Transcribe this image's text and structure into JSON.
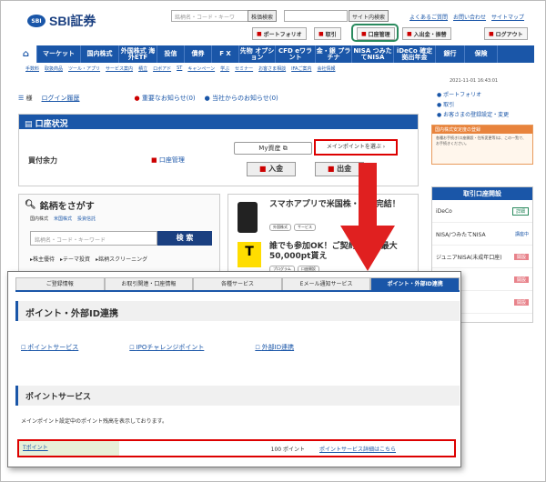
{
  "header": {
    "logo": "SBI証券",
    "search_placeholder": "銘柄名・コード・キーワ",
    "stock_search_btn": "株価検索",
    "site_search_btn": "サイト内検索",
    "links": [
      "よくあるご質問",
      "お問い合わせ",
      "サイトマップ"
    ],
    "buttons": [
      "ポートフォリオ",
      "取引",
      "口座管理",
      "入出金・振替",
      "ログアウト"
    ]
  },
  "nav": {
    "items": [
      "マーケット",
      "国内株式",
      "外国株式 海外ETF",
      "投信",
      "債券",
      "F X",
      "先物 オプション",
      "CFD eワラント",
      "金・銀 プラチナ",
      "NISA つみたてNISA",
      "iDeCo 確定拠出年金",
      "銀行",
      "保険"
    ],
    "sub": [
      "手数料",
      "取扱商品",
      "ツール・アプリ",
      "サービス案内",
      "積立",
      "ロボアド",
      "ST",
      "キャンペーン",
      "学ぶ",
      "セミナー",
      "お客さま相談",
      "IFAご案内",
      "会社情報"
    ]
  },
  "userline": {
    "suffix": "様",
    "login_history": "ログイン履歴",
    "important": "重要なお知らせ(0)",
    "notice": "当社からのお知らせ(0)"
  },
  "account": {
    "title": "口座状況",
    "power_label": "買付余力",
    "mgmt_link": "口座管理",
    "my_assets": "My資産",
    "main_point": "メインポイントを選ぶ",
    "deposit": "入金",
    "withdraw": "出金"
  },
  "search": {
    "title": "銘柄をさがす",
    "tabs": [
      "国内株式",
      "米国株式",
      "投資信託"
    ],
    "placeholder": "銘柄名・コード・キーワード",
    "button": "検 索",
    "links": [
      "株主優待",
      "テーマ投資",
      "銘柄スクリーニング"
    ]
  },
  "promo": {
    "item1": "スマホアプリで米国株・・・完結！",
    "item1_tags": [
      "外国株式",
      "サービス"
    ],
    "item2": "誰でも参加OK！ご契約・・・最大50,000pt貰え",
    "item2_tags": [
      "プログラム",
      "口座開設"
    ],
    "tpoint_label": "T"
  },
  "side": {
    "date": "2021-11-01 16:43:01",
    "links": [
      "ポートフォリオ",
      "取引",
      "お客さまの登録設定・変更"
    ],
    "box_title": "国内株式安定度の登録",
    "box_body": "各種お手続き(口座開設・住所変更等)は、この一覧で、お手続きください。",
    "list_title": "取引口座開設",
    "list": [
      {
        "label": "iDeCo",
        "tag": "詳細",
        "style": "g"
      },
      {
        "label": "NISA/つみたてNISA",
        "tag": "講座中",
        "style": "b"
      },
      {
        "label": "ジュニアNISA(未成年口座)",
        "tag": "開設",
        "style": "p"
      },
      {
        "label": "",
        "tag": "開設",
        "style": "p"
      },
      {
        "label": "",
        "tag": "開設",
        "style": "p"
      }
    ]
  },
  "overlay": {
    "tabs": [
      "ご登録情報",
      "お取引関連・口座情報",
      "各種サービス",
      "Eメール通知サービス",
      "ポイント・外部ID連携"
    ],
    "title": "ポイント・外部ID連携",
    "links": [
      "ポイントサービス",
      "IPOチャレンジポイント",
      "外部ID連携"
    ],
    "section_title": "ポイントサービス",
    "desc": "メインポイント設定中のポイント残高を表示しております。",
    "row_name": "Tポイント",
    "row_value": "100 ポイント",
    "row_link": "ポイントサービス詳細はこちら"
  },
  "colors": {
    "brand": "#1a56a8",
    "highlight_red": "#d00000",
    "highlight_green": "#2a8a5e"
  }
}
